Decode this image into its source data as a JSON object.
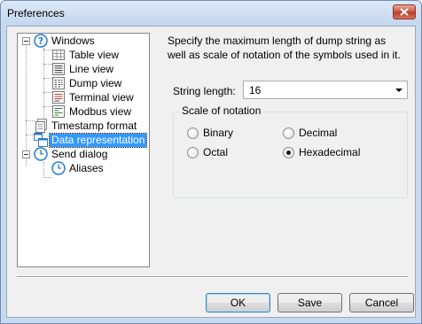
{
  "window": {
    "title": "Preferences"
  },
  "tree": {
    "items": [
      {
        "label": "Windows",
        "icon": "help-icon"
      },
      {
        "label": "Table view",
        "icon": "table-icon"
      },
      {
        "label": "Line view",
        "icon": "lines-icon"
      },
      {
        "label": "Dump view",
        "icon": "dump-icon"
      },
      {
        "label": "Terminal view",
        "icon": "terminal-icon"
      },
      {
        "label": "Modbus view",
        "icon": "modbus-icon"
      },
      {
        "label": "Timestamp format",
        "icon": "document-icon"
      },
      {
        "label": "Data representation",
        "icon": "windows-icon"
      },
      {
        "label": "Send dialog",
        "icon": "clock-icon"
      },
      {
        "label": "Aliases",
        "icon": "clock-icon"
      }
    ],
    "selected": "Data representation"
  },
  "panel": {
    "description": "Specify the maximum length of dump string as well as scale of notation of the symbols used in it.",
    "string_length_label": "String length:",
    "string_length_value": "16",
    "scale_group_label": "Scale of notation",
    "options": [
      "Binary",
      "Decimal",
      "Octal",
      "Hexadecimal"
    ],
    "selected_option": "Hexadecimal"
  },
  "buttons": {
    "ok": "OK",
    "save": "Save",
    "cancel": "Cancel"
  }
}
